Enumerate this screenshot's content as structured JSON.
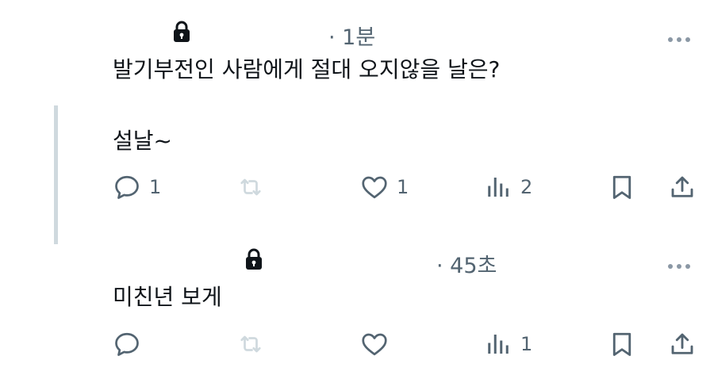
{
  "tweets": [
    {
      "time": "· 1분",
      "text": "발기부전인 사람에게 절대 오지않을 날은?",
      "reply_count": "1",
      "like_count": "1",
      "view_count": "2"
    },
    {
      "time": "· 45초",
      "text": "미친년 보게",
      "reply_count": "",
      "like_count": "",
      "view_count": "1"
    }
  ],
  "reply": {
    "text": "설날~"
  },
  "icons": {
    "reply": "reply-icon",
    "retweet": "retweet-icon",
    "like": "heart-icon",
    "views": "views-icon",
    "bookmark": "bookmark-icon",
    "share": "share-icon",
    "lock": "lock-icon",
    "more": "more-icon"
  },
  "colors": {
    "text": "#0f1419",
    "secondary": "#536471",
    "retweet_disabled": "#cfd9de",
    "thread_line": "#cfd9de"
  }
}
